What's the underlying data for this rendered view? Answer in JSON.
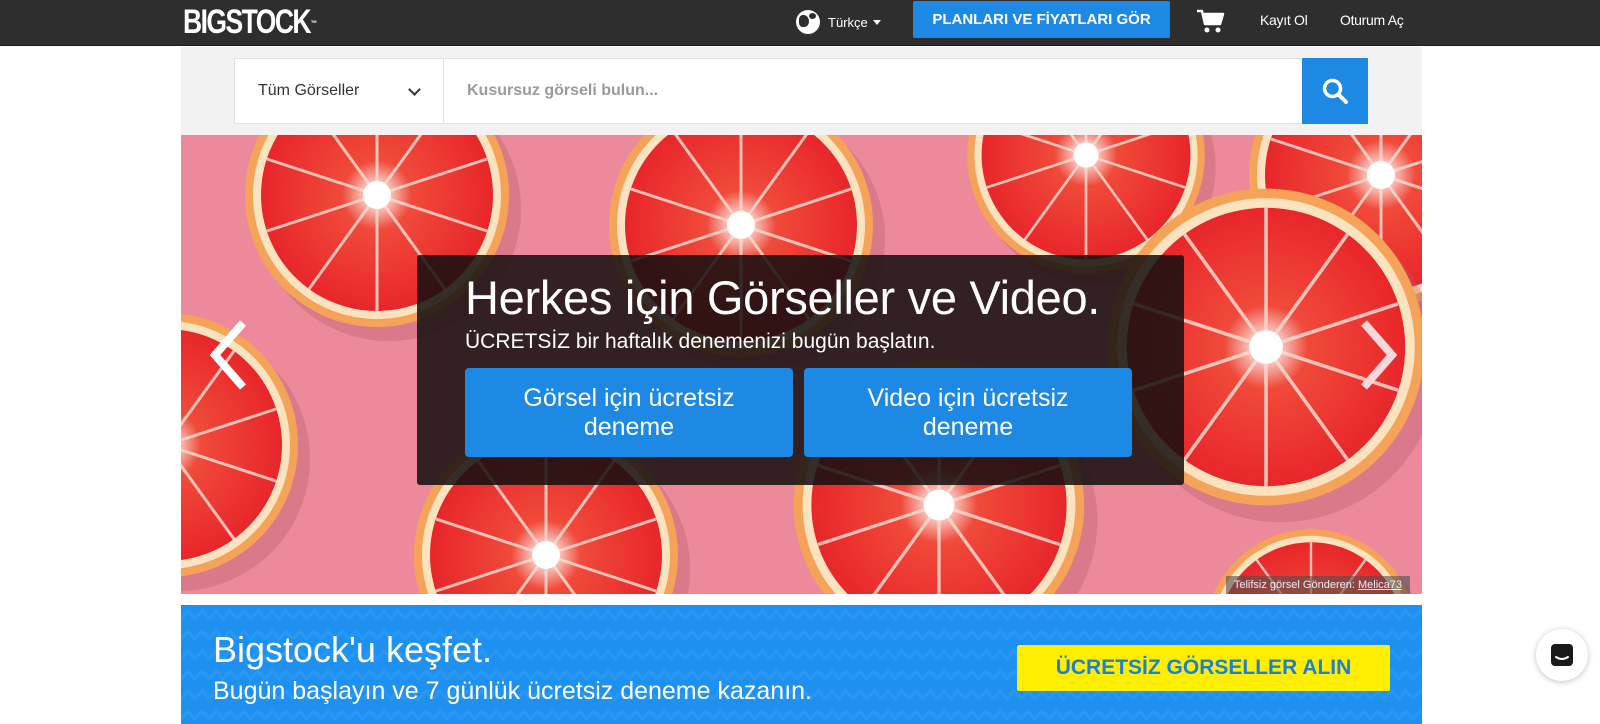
{
  "header": {
    "logo_text": "BIGSTOCK",
    "logo_tm": "™",
    "language": "Türkçe",
    "plans_button": "PLANLARI VE FİYATLARI GÖR",
    "signup": "Kayıt Ol",
    "login": "Oturum Aç",
    "icons": [
      "globe-icon",
      "caret-down-icon",
      "cart-icon"
    ]
  },
  "search": {
    "category": "Tüm Görseller",
    "placeholder": "Kusursuz görseli bulun...",
    "icons": [
      "chevron-down-icon",
      "search-icon"
    ]
  },
  "hero": {
    "title": "Herkes için Görseller ve Video.",
    "subtitle": "ÜCRETSİZ bir haftalık denemenizi bugün başlatın.",
    "image_trial_button": "Görsel için ücretsiz deneme",
    "video_trial_button": "Video için ücretsiz deneme",
    "credit_text": "Telifsiz görsel Gönderen:",
    "credit_author": "Melica73",
    "icons": [
      "arrow-left-icon",
      "arrow-right-icon"
    ]
  },
  "promo": {
    "title": "Bigstock'u keşfet.",
    "subtitle": "Bugün başlayın ve 7 günlük ücretsiz deneme kazanın.",
    "button": "ÜCRETSİZ GÖRSELLER ALIN"
  },
  "colors": {
    "topbar": "#2e2e2e",
    "accent_blue": "#1e88e5",
    "hero_pink": "#ec8a9c",
    "promo_blue": "#1e90f0",
    "promo_button_yellow": "#ffee00"
  }
}
